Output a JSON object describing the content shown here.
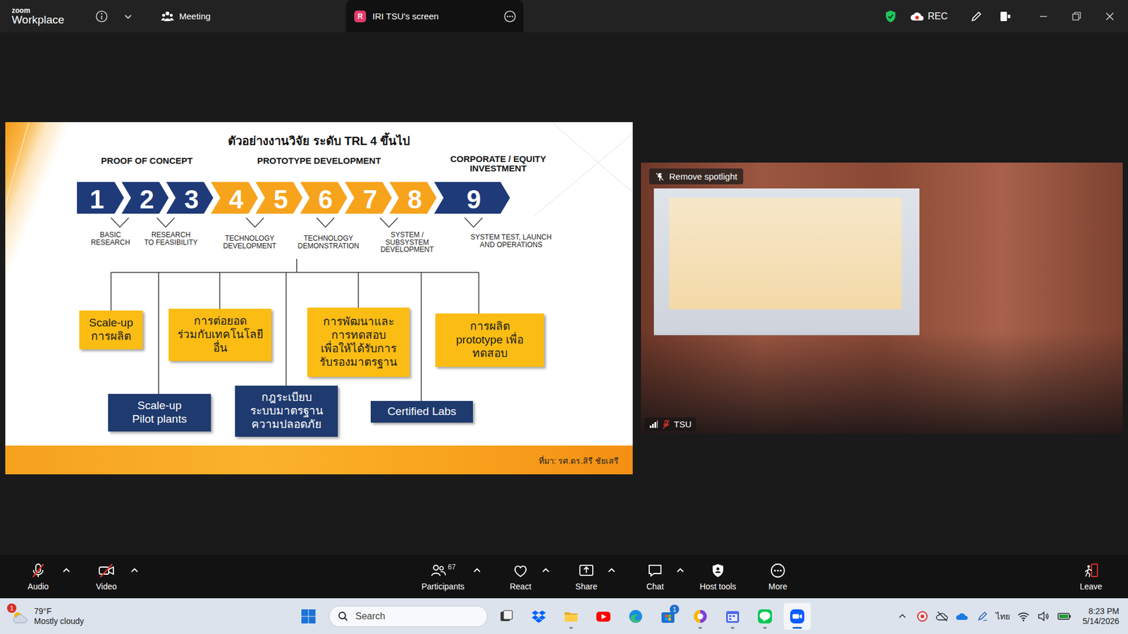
{
  "top_bar": {
    "logo_top": "zoom",
    "logo_bottom": "Workplace",
    "meeting": "Meeting",
    "share_tab": {
      "badge": "R",
      "label": "IRI TSU's screen"
    },
    "recording": "REC"
  },
  "slide": {
    "title": "ตัวอย่างงานวิจัย ระดับ TRL 4 ขึ้นไป",
    "phases": [
      {
        "lines": [
          "PROOF OF CONCEPT"
        ]
      },
      {
        "lines": [
          "PROTOTYPE DEVELOPMENT"
        ]
      },
      {
        "lines": [
          "CORPORATE /  EQUITY",
          "INVESTMENT"
        ]
      }
    ],
    "levels": [
      {
        "number": "1",
        "color": "#1e3a78"
      },
      {
        "number": "2",
        "color": "#1e3a78"
      },
      {
        "number": "3",
        "color": "#1e3a78"
      },
      {
        "number": "4",
        "color": "#f7a31c"
      },
      {
        "number": "5",
        "color": "#f7a31c"
      },
      {
        "number": "6",
        "color": "#f7a31c"
      },
      {
        "number": "7",
        "color": "#f7a31c"
      },
      {
        "number": "8",
        "color": "#f7a31c"
      },
      {
        "number": "9",
        "color": "#1e3a78"
      }
    ],
    "stages": [
      {
        "lines": [
          "BASIC",
          "RESEARCH"
        ]
      },
      {
        "lines": [
          "RESEARCH",
          "TO FEASIBILITY"
        ]
      },
      {
        "lines": [
          "TECHNOLOGY",
          "DEVELOPMENT"
        ]
      },
      {
        "lines": [
          "TECHNOLOGY",
          "DEMONSTRATION"
        ]
      },
      {
        "lines": [
          "SYSTEM /",
          "SUBSYSTEM",
          "DEVELOPMENT"
        ]
      },
      {
        "lines": [
          "SYSTEM TEST, LAUNCH",
          "AND OPERATIONS"
        ]
      }
    ],
    "examples": [
      {
        "kind": "yellow",
        "lines": [
          "Scale-up",
          "การผลิต"
        ]
      },
      {
        "kind": "navy",
        "lines": [
          "Scale-up",
          "Pilot plants"
        ]
      },
      {
        "kind": "yellow",
        "lines": [
          "การต่อยอด",
          "ร่วมกับเทคโนโลยี",
          "อื่น"
        ]
      },
      {
        "kind": "navy",
        "lines": [
          "กฎระเบียบ",
          "ระบบมาตรฐาน",
          "ความปลอดภัย"
        ]
      },
      {
        "kind": "yellow",
        "lines": [
          "การพัฒนาและ",
          "การทดสอบ",
          "เพื่อให้ได้รับการ",
          "รับรองมาตรฐาน"
        ]
      },
      {
        "kind": "navy",
        "lines": [
          "Certified Labs"
        ]
      },
      {
        "kind": "yellow",
        "lines": [
          "การผลิต",
          "prototype เพื่อ",
          "ทดสอบ"
        ]
      }
    ],
    "source": "ที่มา: รศ.ดร.สิรี ชัยเสรี"
  },
  "video_tile": {
    "spotlight_button": "Remove spotlight",
    "name": "TSU",
    "mic_muted": true
  },
  "toolbar": {
    "left": [
      {
        "label": "Audio",
        "kind": "audio",
        "off": true,
        "menu": true
      },
      {
        "label": "Video",
        "kind": "video",
        "off": true,
        "menu": true
      }
    ],
    "center": [
      {
        "label": "Participants",
        "kind": "participants",
        "count": "67",
        "menu": true
      },
      {
        "label": "React",
        "kind": "react",
        "menu": true
      },
      {
        "label": "Share",
        "kind": "share",
        "menu": true
      },
      {
        "label": "Chat",
        "kind": "chat",
        "menu": true
      },
      {
        "label": "Host tools",
        "kind": "host",
        "menu": false
      },
      {
        "label": "More",
        "kind": "more",
        "menu": false
      }
    ],
    "leave": {
      "label": "Leave"
    }
  },
  "taskbar": {
    "weather": {
      "badge": "1",
      "temperature": "79°F",
      "condition": "Mostly cloudy"
    },
    "search": {
      "placeholder": "Search"
    },
    "apps": [
      {
        "kind": "taskview",
        "running": false,
        "selected": false
      },
      {
        "kind": "dropbox",
        "running": false,
        "selected": false
      },
      {
        "kind": "explorer",
        "running": true,
        "selected": false
      },
      {
        "kind": "youtube",
        "running": false,
        "selected": false
      },
      {
        "kind": "edge",
        "running": false,
        "selected": false
      },
      {
        "kind": "store",
        "running": false,
        "selected": false,
        "badge": "1"
      },
      {
        "kind": "copilot",
        "running": true,
        "selected": false
      },
      {
        "kind": "calendar",
        "running": true,
        "selected": false
      },
      {
        "kind": "line",
        "running": true,
        "selected": false
      },
      {
        "kind": "zoom",
        "running": true,
        "selected": true
      }
    ],
    "tray": {
      "language": "ไทย",
      "time": "8:23 PM",
      "date": "5/14/2026"
    }
  }
}
